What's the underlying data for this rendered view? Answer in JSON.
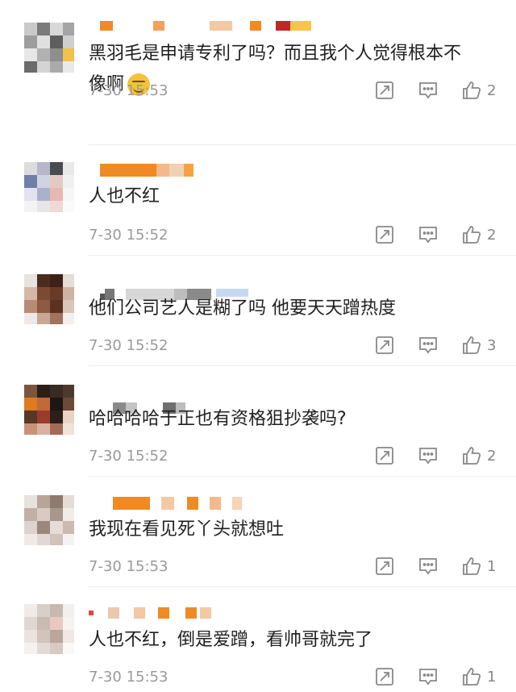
{
  "colors": {
    "text": "#1f1f1f",
    "meta": "#9a9a9a",
    "action_icon": "#888888",
    "divider": "#ececec",
    "username_accent": "#f08a24"
  },
  "comments": [
    {
      "text_line1": "黑羽毛是申请专利了吗？而且我个人觉得根本不",
      "text_line2": "像啊",
      "has_emoji": true,
      "time": "7-30 15:53",
      "likes": "2"
    },
    {
      "text_line1": "人也不红",
      "text_line2": "",
      "has_emoji": false,
      "time": "7-30 15:52",
      "likes": "2"
    },
    {
      "text_line1": "他们公司艺人是糊了吗 他要天天蹭热度",
      "text_line2": "",
      "has_emoji": false,
      "time": "7-30 15:52",
      "likes": "3"
    },
    {
      "text_line1": "哈哈哈哈于正也有资格狙抄袭吗?",
      "text_line2": "",
      "has_emoji": false,
      "time": "7-30 15:52",
      "likes": "2"
    },
    {
      "text_line1": "我现在看见死丫头就想吐",
      "text_line2": "",
      "has_emoji": false,
      "time": "7-30 15:53",
      "likes": "1"
    },
    {
      "text_line1": "人也不红，倒是爱蹭，看帅哥就完了",
      "text_line2": "",
      "has_emoji": false,
      "time": "7-30 15:53",
      "likes": "1"
    }
  ],
  "icons": {
    "repost": "repost-icon",
    "comment": "comment-icon",
    "like": "thumbs-up-icon"
  }
}
